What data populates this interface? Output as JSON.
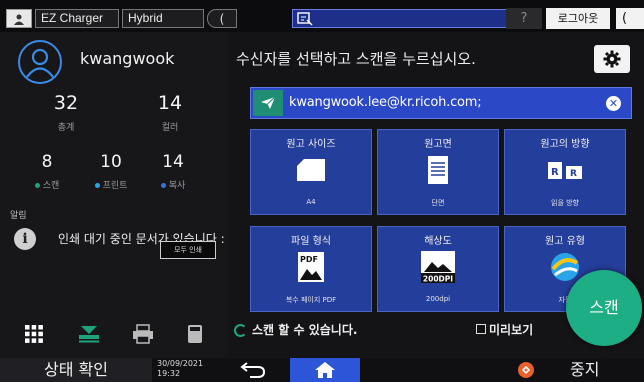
{
  "topbar": {
    "app1": "EZ Charger",
    "app2": "Hybrid",
    "help": "?",
    "logout": "로그아웃",
    "power": "(",
    "mode_glyph": "("
  },
  "user": {
    "name": "kwangwook",
    "total": {
      "value": "32",
      "label": "총계"
    },
    "color": {
      "value": "14",
      "label": "컬러"
    },
    "scan": {
      "value": "8",
      "label": "스캔",
      "dot": "#1ea37d"
    },
    "print": {
      "value": "10",
      "label": "프린트",
      "dot": "#2aa4e8"
    },
    "copy": {
      "value": "14",
      "label": "복사",
      "dot": "#3a73e0"
    }
  },
  "notice": {
    "header": "알림",
    "text": "인쇄 대기 중인 문서가 있습니다 :",
    "button": "모두 인쇄"
  },
  "main": {
    "instruction": "수신자를 선택하고 스캔을 누르십시오.",
    "destination": "kwangwook.lee@kr.ricoh.com;",
    "clear": "✕"
  },
  "tiles": [
    {
      "title": "원고 사이즈",
      "value": "A4",
      "icon": "paper-size-icon"
    },
    {
      "title": "원고면",
      "value": "단면",
      "icon": "single-side-icon"
    },
    {
      "title": "원고의 방향",
      "value": "읽을 방향",
      "icon": "orientation-icon"
    },
    {
      "title": "파일 형식",
      "value": "복수 페이지 PDF",
      "icon": "pdf-icon",
      "badge": "PDF"
    },
    {
      "title": "해상도",
      "value": "200dpi",
      "icon": "resolution-icon",
      "badge": "200DPI"
    },
    {
      "title": "원고 유형",
      "value": "자동",
      "icon": "original-type-icon"
    }
  ],
  "footer": {
    "ready": "스캔 할 수 있습니다.",
    "preview": "미리보기",
    "scan_button": "스캔"
  },
  "bottombar": {
    "status": "상태 확인",
    "date": "30/09/2021",
    "time": "19:32",
    "stop": "중지"
  },
  "colors": {
    "tile": "#243e9b",
    "destination": "#2b48c6",
    "scan_button": "#1dae85",
    "home": "#2d55d8"
  }
}
